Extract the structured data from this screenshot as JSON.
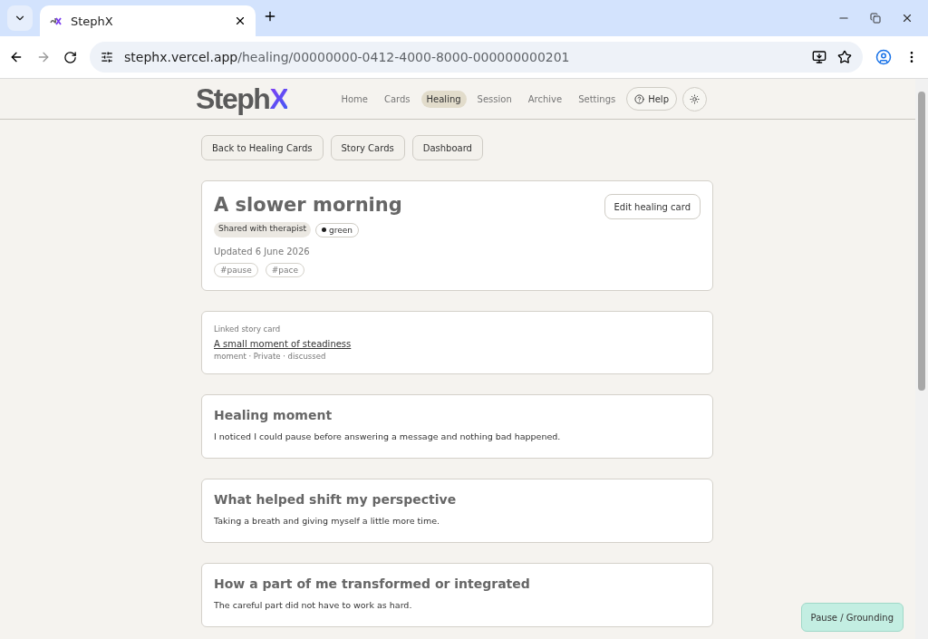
{
  "browser": {
    "tab_title": "StephX",
    "url_host": "stephx.vercel.app",
    "url_path": "/healing/00000000-0412-4000-8000-000000000201"
  },
  "logo": {
    "main": "Steph",
    "accent": "X"
  },
  "nav": [
    {
      "label": "Home",
      "selected": false
    },
    {
      "label": "Cards",
      "selected": false
    },
    {
      "label": "Healing",
      "selected": true
    },
    {
      "label": "Session",
      "selected": false
    },
    {
      "label": "Archive",
      "selected": false
    },
    {
      "label": "Settings",
      "selected": false
    }
  ],
  "help_button": "Help",
  "actions": [
    "Back to Healing Cards",
    "Story Cards",
    "Dashboard"
  ],
  "card": {
    "title": "A slower morning",
    "edit_button": "Edit healing card",
    "sharing": "Shared with therapist",
    "status": {
      "label": "green",
      "color": "#1f1f1f"
    },
    "updated": "Updated 6 June 2026",
    "tags": [
      "#pause",
      "#pace"
    ]
  },
  "linked_story": {
    "label": "Linked story card",
    "title": "A small moment of steadiness",
    "meta": "moment · Private · discussed"
  },
  "sections": [
    {
      "heading": "Healing moment",
      "body": "I noticed I could pause before answering a message and nothing bad happened."
    },
    {
      "heading": "What helped shift my perspective",
      "body": "Taking a breath and giving myself a little more time."
    },
    {
      "heading": "How a part of me transformed or integrated",
      "body": "The careful part did not have to work as hard."
    }
  ],
  "grounding_button": "Pause / Grounding"
}
